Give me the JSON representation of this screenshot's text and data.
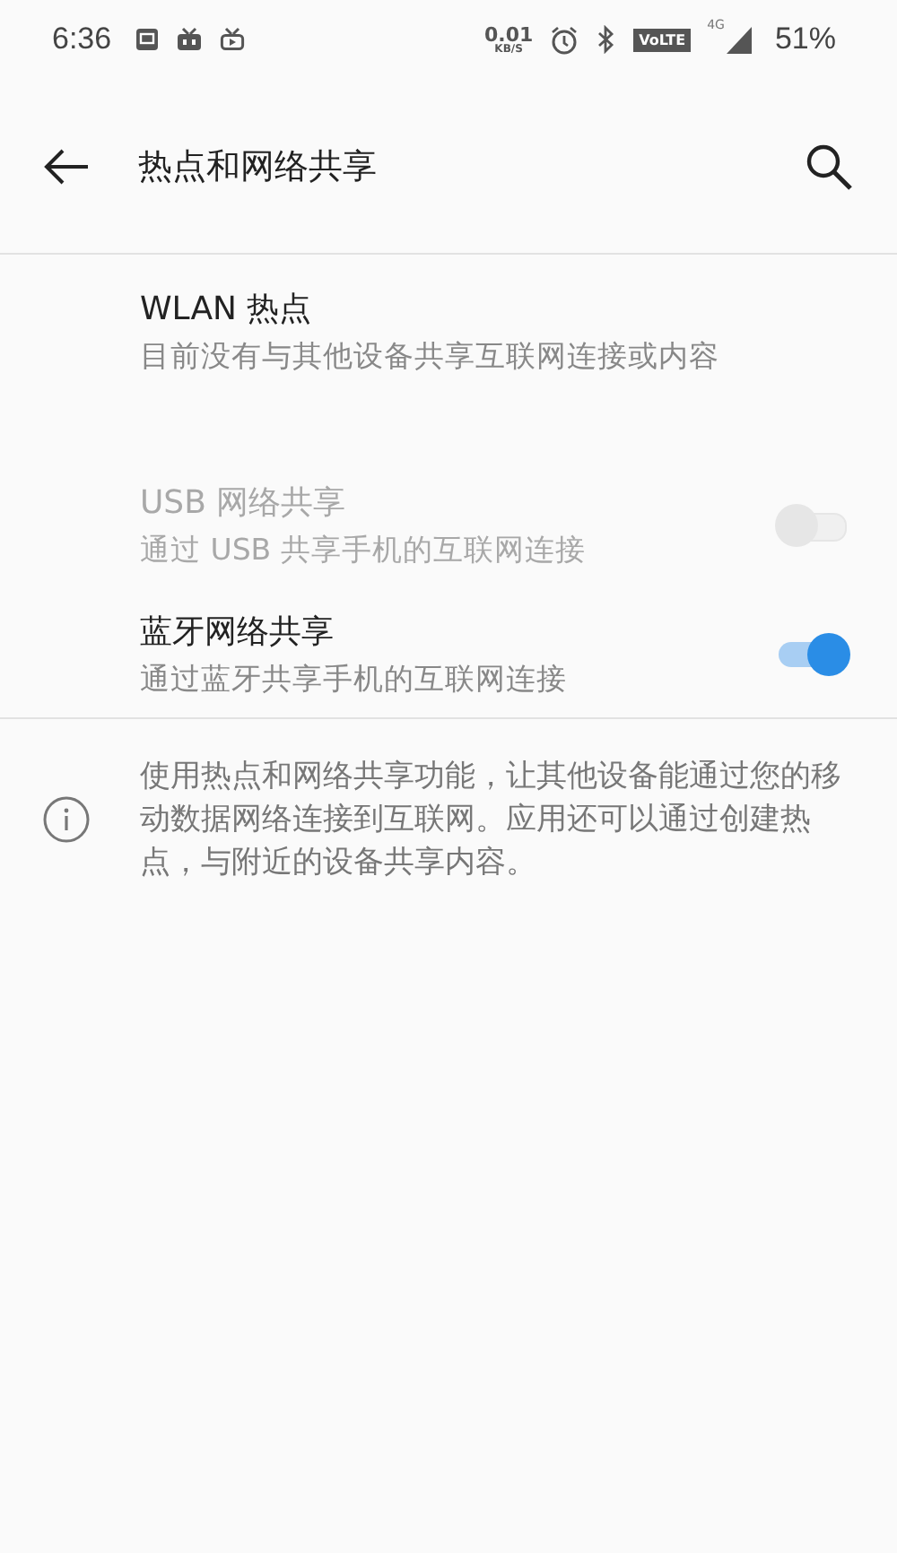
{
  "status_bar": {
    "time": "6:36",
    "speed_value": "0.01",
    "speed_unit": "KB/S",
    "volte": "VoLTE",
    "network": "4G",
    "battery": "51%"
  },
  "toolbar": {
    "title": "热点和网络共享"
  },
  "items": [
    {
      "kind": "link",
      "title": "WLAN 热点",
      "subtitle": "目前没有与其他设备共享互联网连接或内容",
      "disabled": false
    },
    {
      "kind": "toggle",
      "title": "USB 网络共享",
      "subtitle": "通过 USB 共享手机的互联网连接",
      "disabled": true,
      "on": false
    },
    {
      "kind": "toggle",
      "title": "蓝牙网络共享",
      "subtitle": "通过蓝牙共享手机的互联网连接",
      "disabled": false,
      "on": true
    }
  ],
  "info": {
    "text": "使用热点和网络共享功能，让其他设备能通过您的移动数据网络连接到互联网。应用还可以通过创建热点，与附近的设备共享内容。"
  }
}
